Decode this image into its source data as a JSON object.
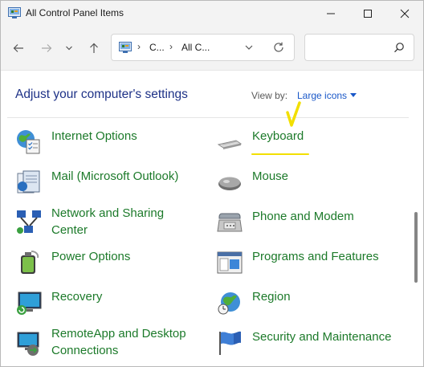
{
  "window": {
    "title": "All Control Panel Items",
    "controls": {
      "minimize": "minimize",
      "maximize": "maximize",
      "close": "close"
    }
  },
  "nav": {
    "address_segments": [
      "C...",
      "All C..."
    ],
    "search_placeholder": ""
  },
  "content": {
    "heading": "Adjust your computer's settings",
    "view_by_label": "View by:",
    "view_by_value": "Large icons",
    "items": [
      {
        "label": "Internet Options",
        "icon": "internet-options-icon"
      },
      {
        "label": "Keyboard",
        "icon": "keyboard-icon"
      },
      {
        "label": "Mail (Microsoft Outlook)",
        "icon": "mail-icon"
      },
      {
        "label": "Mouse",
        "icon": "mouse-icon"
      },
      {
        "label": "Network and Sharing\nCenter",
        "icon": "network-icon"
      },
      {
        "label": "Phone and Modem",
        "icon": "phone-icon"
      },
      {
        "label": "Power Options",
        "icon": "power-icon"
      },
      {
        "label": "Programs and Features",
        "icon": "programs-icon"
      },
      {
        "label": "Recovery",
        "icon": "recovery-icon"
      },
      {
        "label": "Region",
        "icon": "region-icon"
      },
      {
        "label": "RemoteApp and Desktop\nConnections",
        "icon": "remoteapp-icon"
      },
      {
        "label": "Security and Maintenance",
        "icon": "security-icon"
      }
    ]
  },
  "colors": {
    "link_green": "#1c7a2a",
    "heading_blue": "#1e3287",
    "accent_blue": "#1a58c8",
    "annotation_yellow": "#f2df00"
  }
}
